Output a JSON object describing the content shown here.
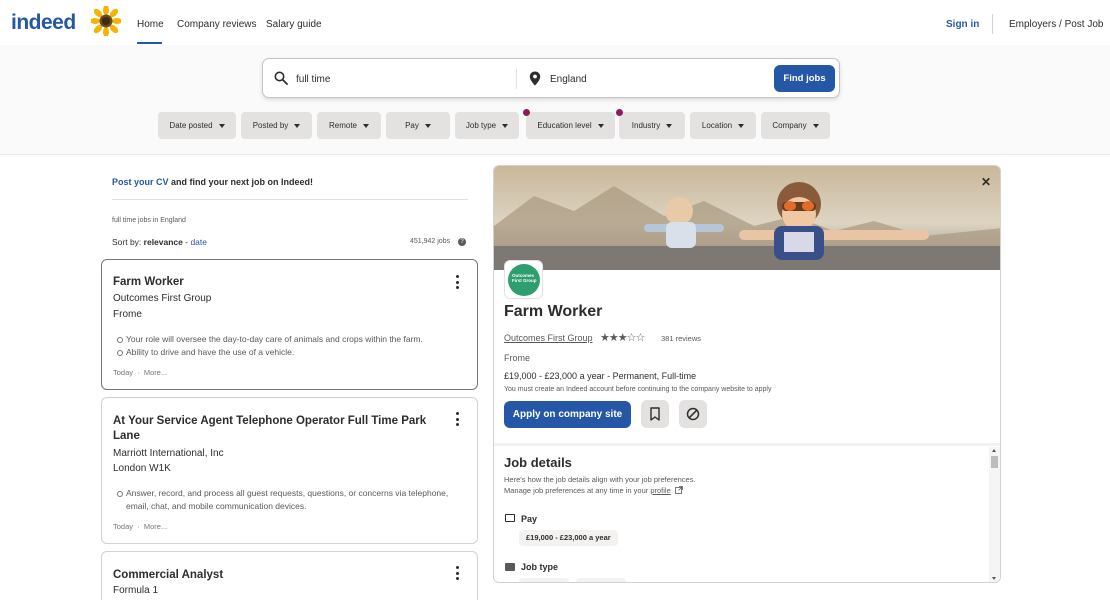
{
  "header": {
    "logo": "indeed",
    "nav": [
      "Home",
      "Company reviews",
      "Salary guide"
    ],
    "sign_in": "Sign in",
    "employers": "Employers / Post Job"
  },
  "search": {
    "what_value": "full time",
    "where_value": "England",
    "find_label": "Find jobs"
  },
  "filters": [
    {
      "label": "Date posted",
      "dot": false
    },
    {
      "label": "Posted by",
      "dot": false
    },
    {
      "label": "Remote",
      "dot": false
    },
    {
      "label": "Pay",
      "dot": false
    },
    {
      "label": "Job type",
      "dot": false
    },
    {
      "label": "Education level",
      "dot": true
    },
    {
      "label": "Industry",
      "dot": true
    },
    {
      "label": "Location",
      "dot": false
    },
    {
      "label": "Company",
      "dot": false
    }
  ],
  "left": {
    "post_cv_link": "Post your CV",
    "post_cv_rest": " and find your next job on Indeed!",
    "query_text": "full time jobs in England",
    "sort_label": "Sort by: ",
    "sort_relevance": "relevance",
    "sort_sep": " - ",
    "sort_date": "date",
    "job_count": "451,942 jobs"
  },
  "jobs": [
    {
      "title": "Farm Worker",
      "company": "Outcomes First Group",
      "location": "Frome",
      "snippets": [
        "Your role will oversee the day-to-day care of animals and crops within the farm.",
        "Ability to drive and have the use of a vehicle."
      ],
      "posted": "Today",
      "more": "More..."
    },
    {
      "title": "At Your Service Agent Telephone Operator Full Time Park Lane",
      "company": "Marriott International, Inc",
      "location": "London W1K",
      "snippets": [
        "Answer, record, and process all guest requests, questions, or concerns via telephone, email, chat, and mobile communication devices."
      ],
      "posted": "Today",
      "more": "More..."
    },
    {
      "title": "Commercial Analyst",
      "company": "Formula 1"
    }
  ],
  "panel": {
    "logo_text": "Outcomes First Group",
    "title": "Farm Worker",
    "company": "Outcomes First Group",
    "rating": 3,
    "stars": "★★★☆☆",
    "reviews": "381 reviews",
    "location": "Frome",
    "pay_line": "£19,000 - £23,000 a year  - Permanent, Full-time",
    "account_note": "You must create an Indeed account before continuing to the company website to apply",
    "apply_label": "Apply on company site",
    "details_title": "Job details",
    "details_sub1": "Here's how the job details align with your job preferences.",
    "details_sub2": "Manage job preferences at any time in your ",
    "profile_link": "profile",
    "pay_heading": "Pay",
    "pay_chip": "£19,000 - £23,000 a year",
    "jobtype_heading": "Job type"
  },
  "colors": {
    "brand_blue": "#2557a7",
    "filter_dot": "#8a1d5e",
    "logo_green": "#2f9e6e"
  },
  "icons": [
    "search-icon",
    "location-pin-icon",
    "kebab-icon",
    "close-icon",
    "bookmark-icon",
    "not-interested-icon",
    "help-icon",
    "external-link-icon",
    "money-icon",
    "briefcase-icon",
    "star-icon"
  ]
}
